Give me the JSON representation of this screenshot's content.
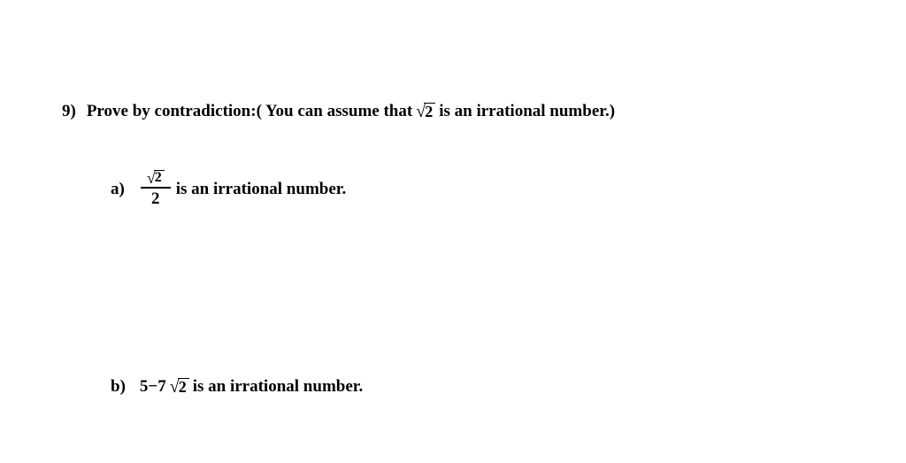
{
  "question": {
    "number": "9)",
    "text_before": "Prove by contradiction:( You can assume that ",
    "sqrt_radicand": "2",
    "text_after": " is an irrational number.)"
  },
  "part_a": {
    "label": "a)",
    "numerator_radicand": "2",
    "denominator": "2",
    "text_after": "is an irrational number."
  },
  "part_b": {
    "label": "b)",
    "expr_before": "5−7",
    "sqrt_radicand": "2",
    "text_after": " is an irrational number."
  }
}
